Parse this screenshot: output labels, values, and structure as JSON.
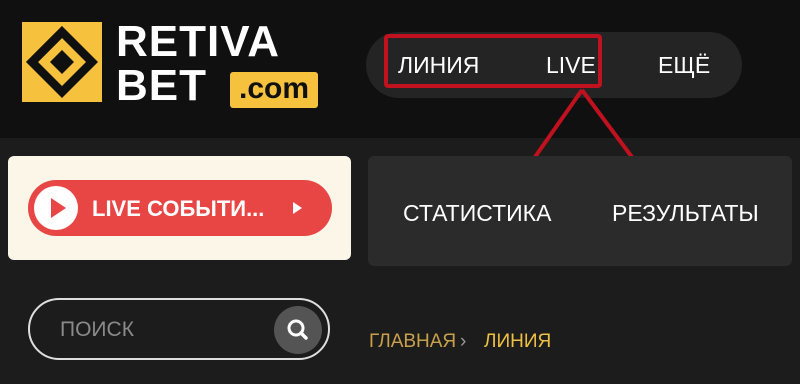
{
  "brand": {
    "word1": "RETIVA",
    "word2": "BET",
    "tld": ".com",
    "accent": "#f6c13c"
  },
  "nav": {
    "items": [
      {
        "label": "ЛИНИЯ"
      },
      {
        "label": "LIVE"
      },
      {
        "label": "ЕЩЁ"
      }
    ]
  },
  "annotation": {
    "color": "#c0121e"
  },
  "live_panel": {
    "button_label": "LIVE СОБЫТИ...",
    "button_color": "#e84545",
    "icons": [
      "play-icon",
      "chevron-right-icon"
    ]
  },
  "sub_nav": {
    "items": [
      {
        "label": "СТАТИСТИКА"
      },
      {
        "label": "РЕЗУЛЬТАТЫ"
      }
    ]
  },
  "search": {
    "placeholder": "ПОИСК",
    "value": "",
    "icon": "search-icon"
  },
  "breadcrumb": {
    "items": [
      {
        "label": "ГЛАВНАЯ"
      },
      {
        "label": "ЛИНИЯ"
      }
    ],
    "separator": "›"
  }
}
